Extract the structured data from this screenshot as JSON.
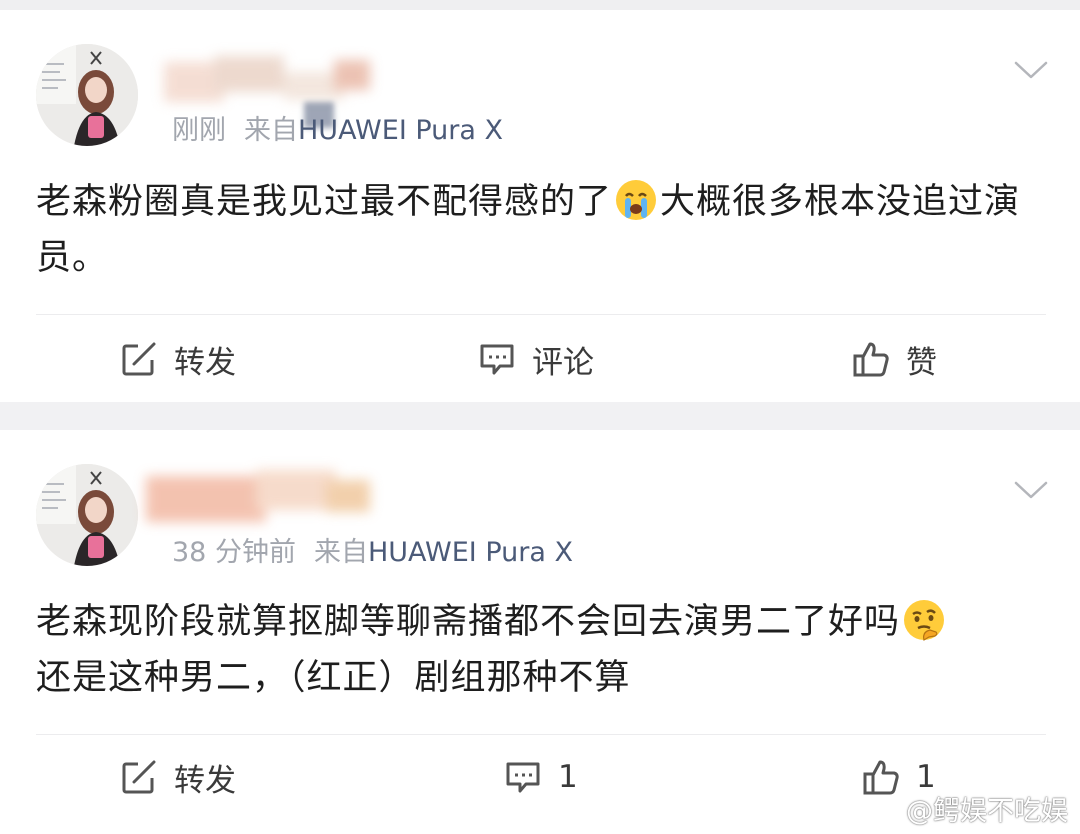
{
  "posts": [
    {
      "time": "刚刚",
      "from_label": "来自",
      "device": "HUAWEI Pura X",
      "text_before_emoji": "老森粉圈真是我见过最不配得感的了",
      "emoji": "crying-emoji",
      "text_after_emoji": "大概很多根本没追过演员。",
      "actions": {
        "repost": "转发",
        "comment": "评论",
        "like": "赞"
      }
    },
    {
      "time": "38 分钟前",
      "from_label": "来自",
      "device": "HUAWEI Pura X",
      "text_before_emoji": "老森现阶段就算抠脚等聊斋播都不会回去演男二了好吗",
      "emoji": "thinking-emoji",
      "text_after_emoji": "还是这种男二，（红正）剧组那种不算",
      "actions": {
        "repost": "转发",
        "comment": "1",
        "like": "1"
      }
    }
  ],
  "watermark": "@鳄娱不吃娱",
  "colors": {
    "background": "#f1f1f3",
    "card": "#ffffff",
    "device_text": "#4b5a78",
    "meta_text": "#a2a6ae"
  }
}
